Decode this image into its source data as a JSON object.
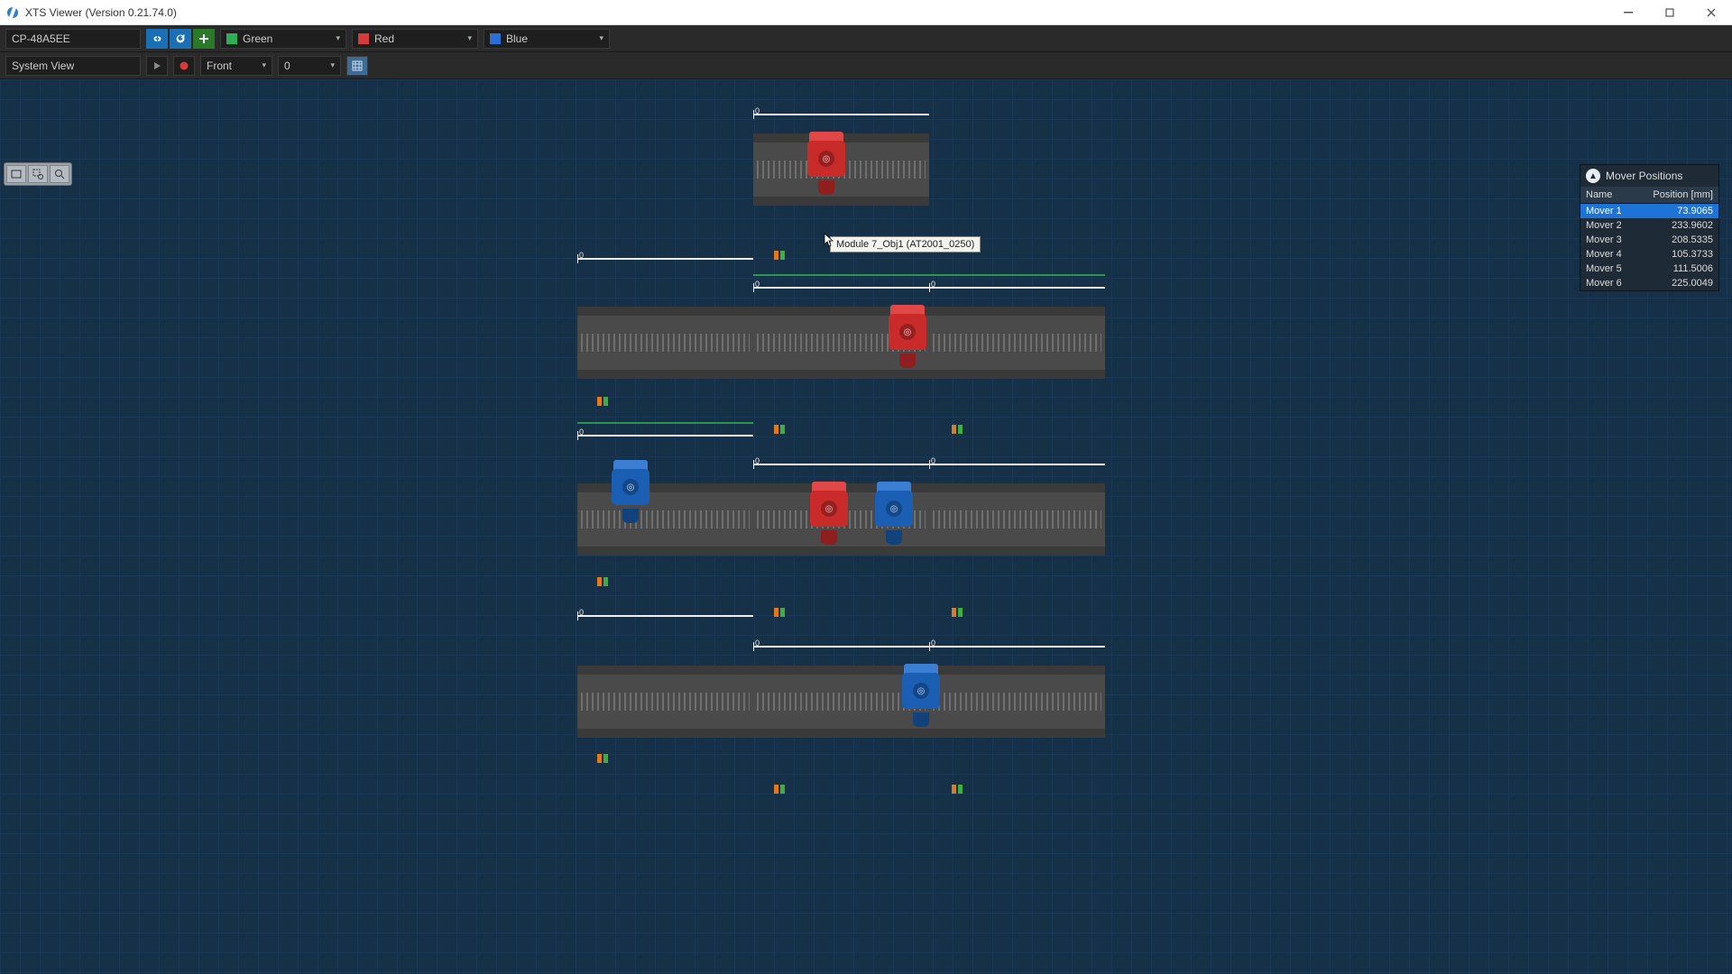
{
  "window": {
    "title": "XTS Viewer (Version 0.21.74.0)"
  },
  "toolbar": {
    "target": "CP-48A5EE",
    "mode_label": "System View",
    "dropdowns": {
      "green": "Green",
      "red": "Red",
      "blue": "Blue",
      "view": "Front",
      "index": "0"
    }
  },
  "tooltip": {
    "text": "Module 7_Obj1 (AT2001_0250)"
  },
  "panel": {
    "title": "Mover Positions",
    "columns": {
      "name": "Name",
      "pos": "Position [mm]"
    },
    "rows": [
      {
        "name": "Mover 1",
        "pos": "73.9065",
        "selected": true
      },
      {
        "name": "Mover 2",
        "pos": "233.9602"
      },
      {
        "name": "Mover 3",
        "pos": "208.5335"
      },
      {
        "name": "Mover 4",
        "pos": "105.3733"
      },
      {
        "name": "Mover 5",
        "pos": "111.5006"
      },
      {
        "name": "Mover 6",
        "pos": "225.0049"
      }
    ]
  },
  "rulers": {
    "zero": "0"
  }
}
